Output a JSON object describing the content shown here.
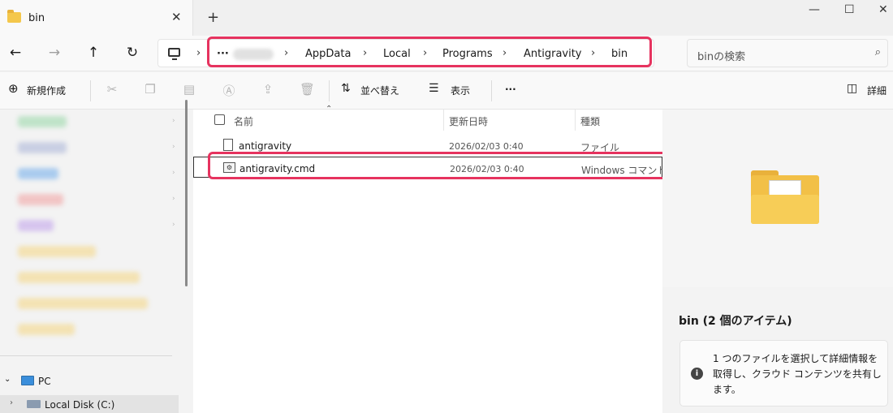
{
  "window": {
    "tab_title": "bin",
    "new_tab": "+",
    "minimize": "—",
    "maximize": "☐",
    "close": "✕"
  },
  "nav": {
    "back": "←",
    "forward": "→",
    "up": "↑",
    "refresh": "↻",
    "overflow": "···",
    "breadcrumb": [
      "AppData",
      "Local",
      "Programs",
      "Antigravity",
      "bin"
    ],
    "search_placeholder": "binの検索"
  },
  "commandbar": {
    "new_label": "新規作成",
    "sort_label": "並べ替え",
    "view_label": "表示",
    "more": "···",
    "details_label": "詳細"
  },
  "sidebar": {
    "pc_label": "PC",
    "disk_label": "Local Disk (C:)"
  },
  "file_list": {
    "columns": [
      "名前",
      "更新日時",
      "種類"
    ],
    "rows": [
      {
        "name": "antigravity",
        "date": "2026/02/03 0:40",
        "type": "ファイル"
      },
      {
        "name": "antigravity.cmd",
        "date": "2026/02/03 0:40",
        "type": "Windows コマンド スクリプト"
      }
    ]
  },
  "details": {
    "title": "bin (2 個のアイテム)",
    "info": "1 つのファイルを選択して詳細情報を取得し、クラウド コンテンツを共有します。"
  },
  "colors": {
    "highlight": "#e6335f",
    "folder": "#f2c047"
  }
}
